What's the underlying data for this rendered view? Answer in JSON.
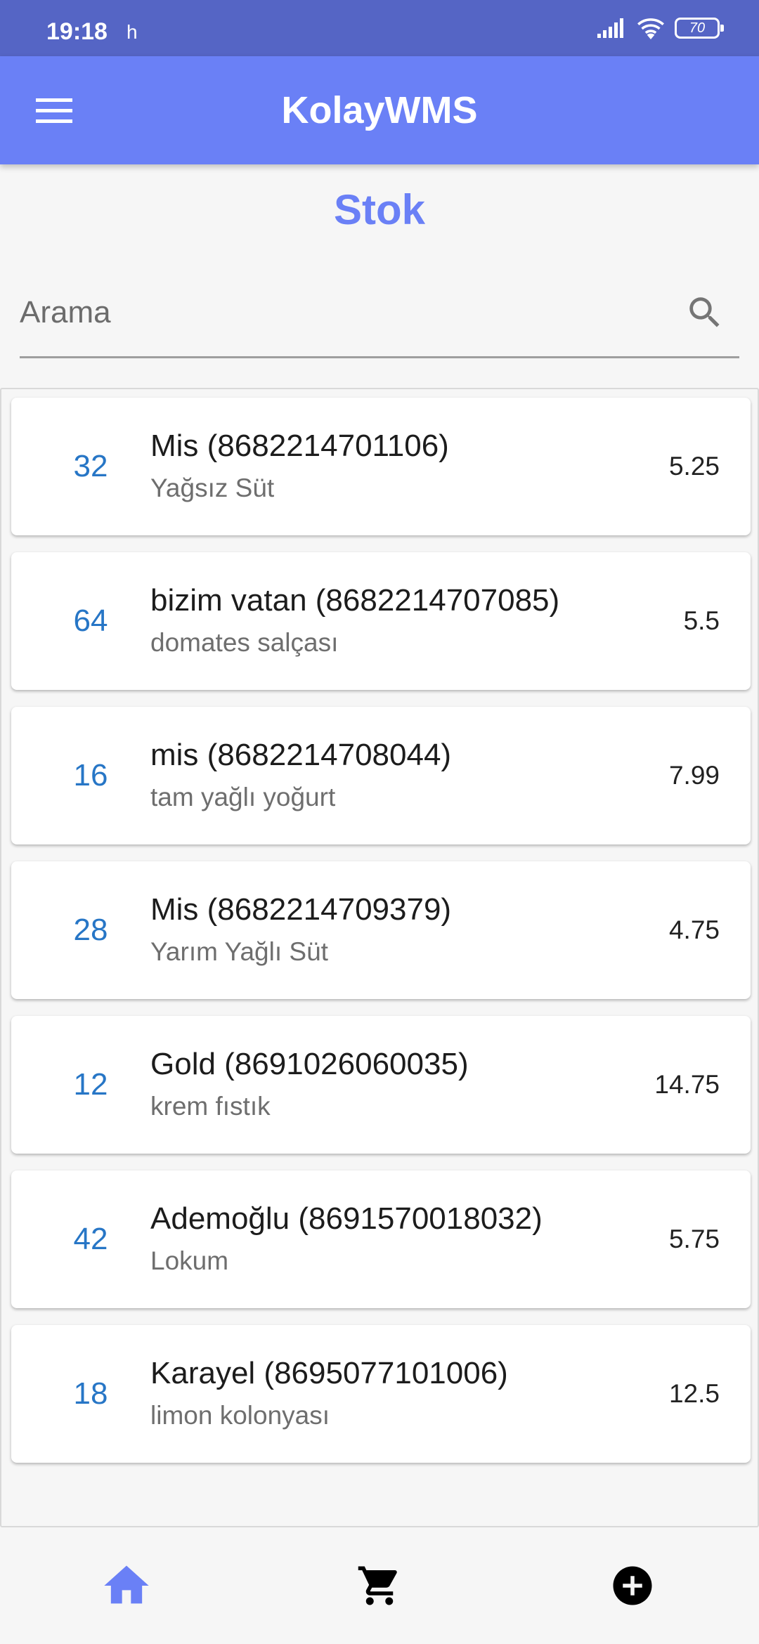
{
  "status_bar": {
    "time": "19:18",
    "extra": "h",
    "battery": "70"
  },
  "app_bar": {
    "title": "KolayWMS"
  },
  "page": {
    "title": "Stok"
  },
  "search": {
    "placeholder": "Arama"
  },
  "items": [
    {
      "qty": "32",
      "name": "Mis (8682214701106)",
      "desc": "Yağsız Süt",
      "price": "5.25"
    },
    {
      "qty": "64",
      "name": "bizim vatan (8682214707085)",
      "desc": "domates salçası",
      "price": "5.5"
    },
    {
      "qty": "16",
      "name": "mis (8682214708044)",
      "desc": "tam yağlı yoğurt",
      "price": "7.99"
    },
    {
      "qty": "28",
      "name": "Mis (8682214709379)",
      "desc": "Yarım Yağlı Süt",
      "price": "4.75"
    },
    {
      "qty": "12",
      "name": "Gold (8691026060035)",
      "desc": "krem fıstık",
      "price": "14.75"
    },
    {
      "qty": "42",
      "name": "Ademoğlu (8691570018032)",
      "desc": "Lokum",
      "price": "5.75"
    },
    {
      "qty": "18",
      "name": "Karayel (8695077101006)",
      "desc": "limon kolonyası",
      "price": "12.5"
    }
  ],
  "bottom_nav": {
    "items": [
      {
        "icon": "home-icon",
        "active": true
      },
      {
        "icon": "cart-icon",
        "active": false
      },
      {
        "icon": "add-circle-icon",
        "active": false
      }
    ]
  },
  "colors": {
    "primary": "#6a80f6",
    "status_bar": "#5565c5",
    "quantity": "#2776c6",
    "active_icon": "#6a80f6",
    "inactive_icon": "#000000"
  }
}
